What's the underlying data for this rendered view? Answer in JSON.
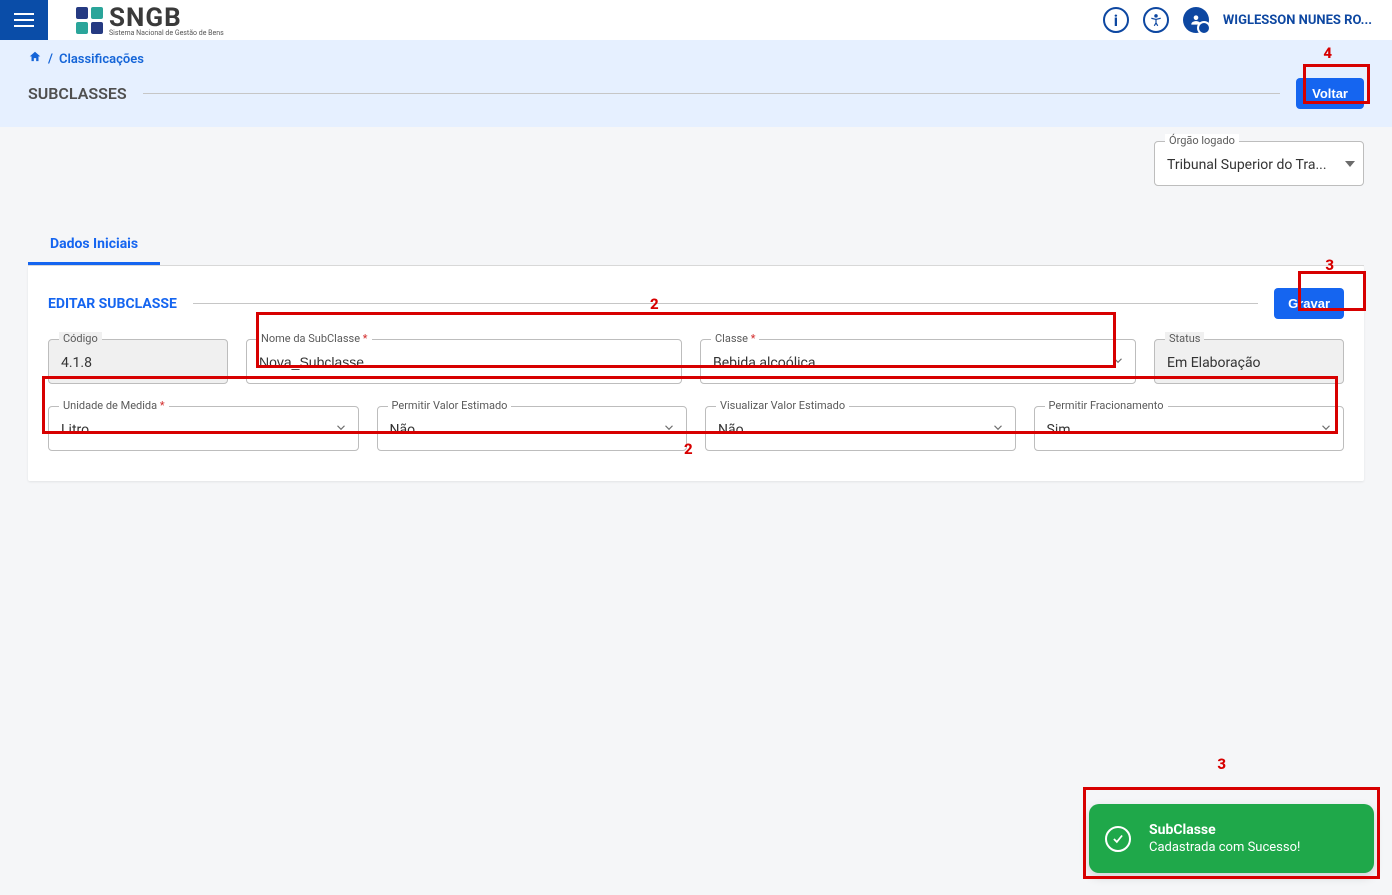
{
  "app": {
    "logo_name": "SNGB",
    "logo_sub": "Sistema Nacional de Gestão de Bens"
  },
  "user": {
    "name": "WIGLESSON NUNES RO..."
  },
  "breadcrumb": {
    "home_icon": "home-icon",
    "separator": "/",
    "item": "Classificações"
  },
  "page": {
    "title": "SUBCLASSES",
    "voltar": "Voltar"
  },
  "orgao": {
    "legend": "Órgão logado",
    "value": "Tribunal Superior do Tra..."
  },
  "tabs": {
    "dados_iniciais": "Dados Iniciais"
  },
  "card": {
    "title": "EDITAR SUBCLASSE",
    "gravar": "Gravar"
  },
  "form": {
    "codigo": {
      "label": "Código",
      "value": "4.1.8"
    },
    "nome": {
      "label": "Nome da SubClasse",
      "value": "Nova_Subclasse"
    },
    "classe": {
      "label": "Classe",
      "value": "Bebida alcoólica"
    },
    "status": {
      "label": "Status",
      "value": "Em Elaboração"
    },
    "un_med": {
      "label": "Unidade de Medida",
      "value": "Litro"
    },
    "perm_val": {
      "label": "Permitir Valor Estimado",
      "value": "Não"
    },
    "vis_val": {
      "label": "Visualizar Valor Estimado",
      "value": "Não"
    },
    "perm_frac": {
      "label": "Permitir Fracionamento",
      "value": "Sim"
    }
  },
  "required_mark": " *",
  "toast": {
    "title": "SubClasse",
    "msg": "Cadastrada com Sucesso!"
  },
  "annotations": {
    "a2": "2",
    "a3": "3",
    "a4": "4"
  }
}
